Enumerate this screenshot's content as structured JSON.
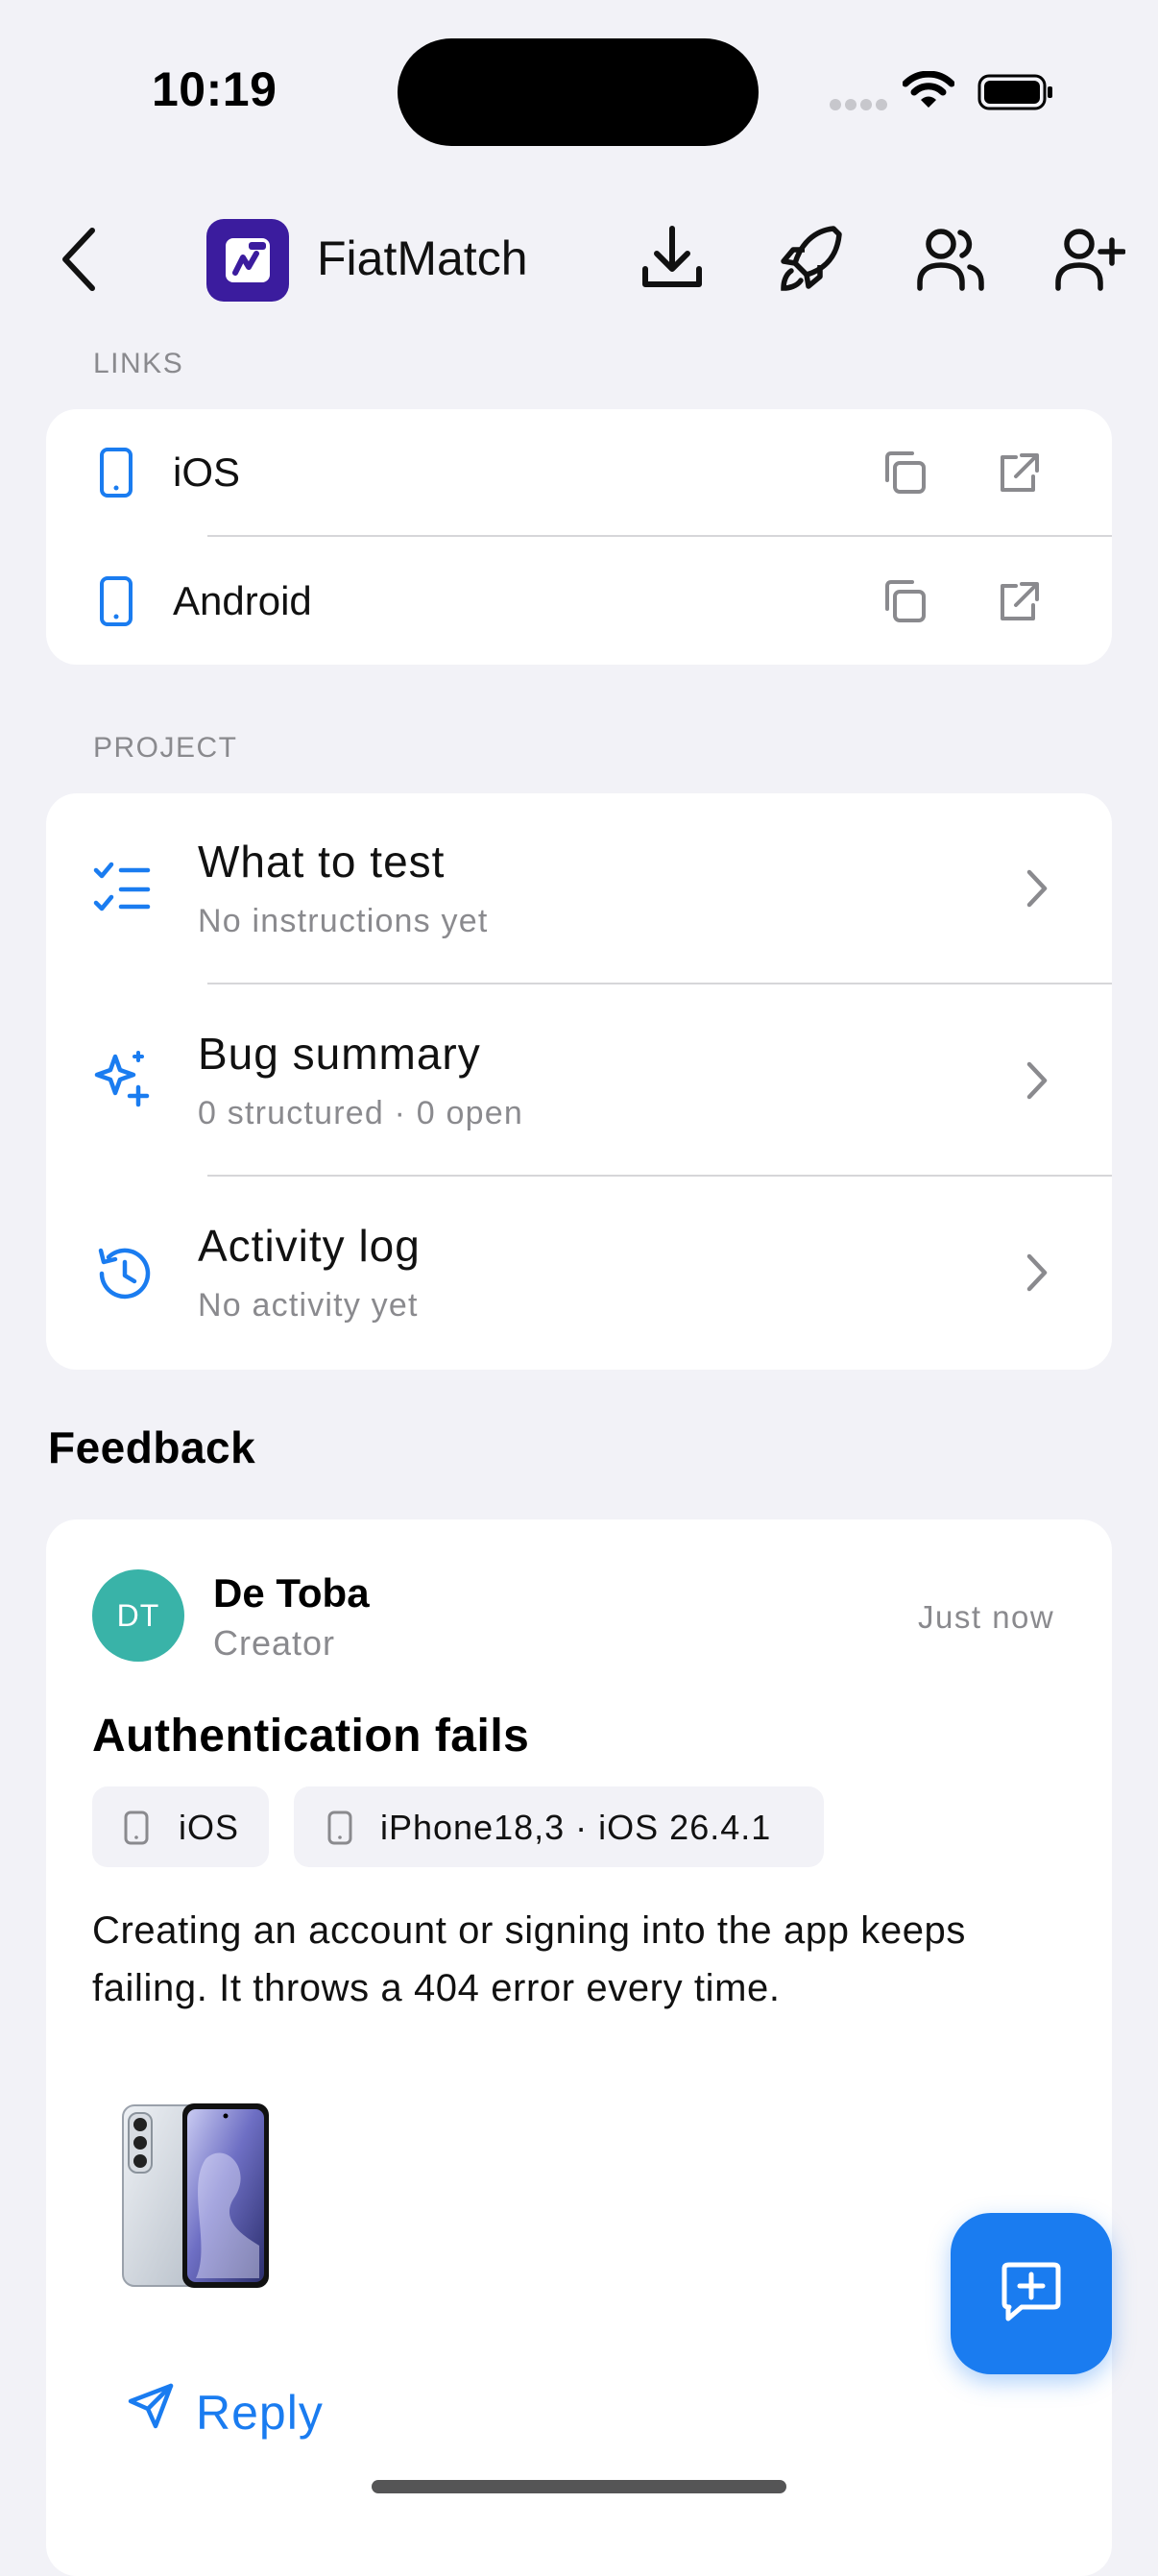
{
  "status_bar": {
    "time": "10:19"
  },
  "header": {
    "app_name": "FiatMatch",
    "icons": [
      "back-chevron-icon",
      "download-icon",
      "rocket-icon",
      "users-icon",
      "add-user-icon"
    ]
  },
  "links": {
    "section_label": "LINKS",
    "items": [
      {
        "label": "iOS",
        "icon": "phone-icon"
      },
      {
        "label": "Android",
        "icon": "phone-icon"
      }
    ]
  },
  "project": {
    "section_label": "PROJECT",
    "items": [
      {
        "title": "What to test",
        "subtitle": "No instructions yet",
        "icon": "checklist-icon"
      },
      {
        "title": "Bug summary",
        "subtitle": "0 structured · 0 open",
        "icon": "sparkles-icon"
      },
      {
        "title": "Activity log",
        "subtitle": "No activity yet",
        "icon": "history-icon"
      }
    ]
  },
  "feedback": {
    "heading": "Feedback",
    "item": {
      "avatar_initials": "DT",
      "author": "De Toba",
      "role": "Creator",
      "timestamp": "Just now",
      "title": "Authentication fails",
      "chips": [
        {
          "label": "iOS",
          "icon": "phone-icon"
        },
        {
          "label": "iPhone18,3 · iOS 26.4.1",
          "icon": "phone-icon"
        }
      ],
      "body": "Creating an account or signing into the app keeps failing. It throws a 404 error every time.",
      "reply_label": "Reply"
    }
  },
  "colors": {
    "accent": "#1a7cf0",
    "background": "#f2f2f7",
    "avatar": "#39b3a8",
    "app_logo": "#3b1c9e"
  }
}
